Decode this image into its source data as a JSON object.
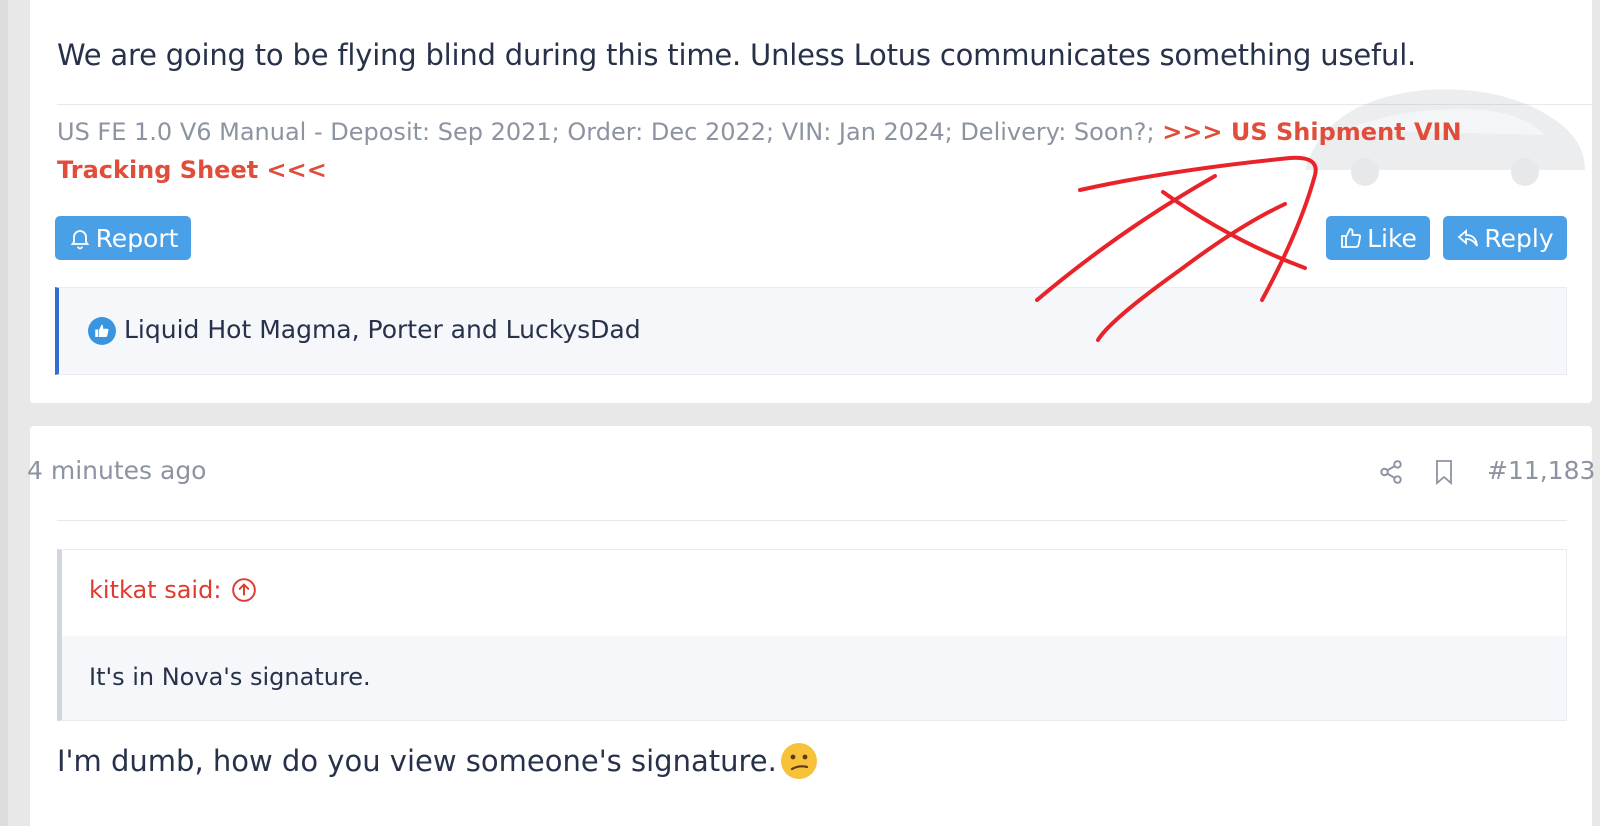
{
  "post1": {
    "text": "We are going to be flying blind during this time. Unless Lotus communicates something useful.",
    "signature_text": "US FE 1.0 V6 Manual - Deposit: Sep 2021; Order: Dec 2022; VIN: Jan 2024; Delivery: Soon?; ",
    "signature_link": ">>> US Shipment VIN Tracking Sheet <<<",
    "report_label": "Report",
    "like_label": "Like",
    "reply_label": "Reply",
    "likers": "Liquid Hot Magma, Porter and LuckysDad"
  },
  "post2": {
    "time": "4 minutes ago",
    "post_number": "#11,183",
    "quote_author": "kitkat said:",
    "quote_body": "It's in Nova's signature.",
    "text": "I'm dumb, how do you view someone's signature."
  },
  "colors": {
    "button_blue": "#4aa0e6",
    "link_red": "#e04d3b",
    "likes_border": "#2f6fd3",
    "annotation_red": "#e8242a"
  },
  "icons": [
    "bell-icon",
    "thumbs-up-icon",
    "reply-icon",
    "share-icon",
    "bookmark-icon",
    "arrow-up-circle-icon",
    "confused-face-emoji"
  ]
}
